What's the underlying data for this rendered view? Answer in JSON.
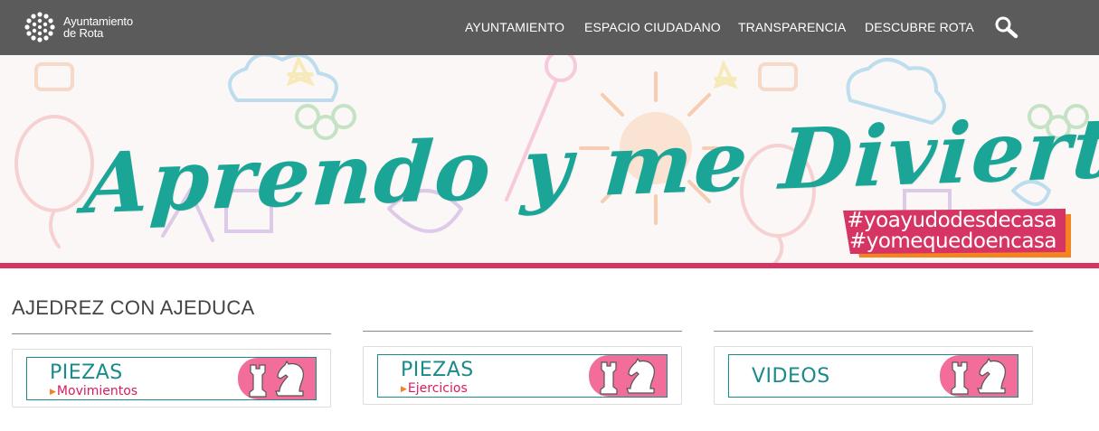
{
  "header": {
    "logo": {
      "line1": "Ayuntamiento",
      "line2": "de Rota",
      "icon": "municipal-logo-icon"
    },
    "nav": [
      {
        "label": "AYUNTAMIENTO"
      },
      {
        "label": "ESPACIO CIUDADANO"
      },
      {
        "label": "TRANSPARENCIA"
      },
      {
        "label": "DESCUBRE ROTA"
      }
    ],
    "search_icon": "search-icon"
  },
  "banner": {
    "title": "Aprendo y me Divierto",
    "hashtags": [
      "#yoayudodesdecasa",
      "#yomequedoencasa"
    ],
    "colors": {
      "title": "#1aa596",
      "hashtag_bg": "#d63564",
      "hashtag_shadow": "#f5831f",
      "bar": "#d63564"
    }
  },
  "section": {
    "title": "AJEDREZ CON AJEDUCA",
    "cards": [
      {
        "main": "PIEZAS",
        "sub": "Movimientos",
        "icon": "chess-rook-knight-icon"
      },
      {
        "main": "PIEZAS",
        "sub": "Ejercicios",
        "icon": "chess-rook-knight-icon"
      },
      {
        "main": "VIDEOS",
        "sub": "",
        "icon": "chess-rook-knight-icon"
      }
    ],
    "colors": {
      "teal": "#1a8a8a",
      "pink": "#f26d9a",
      "sub_text": "#d81b60",
      "arrow": "#f5831f"
    }
  }
}
